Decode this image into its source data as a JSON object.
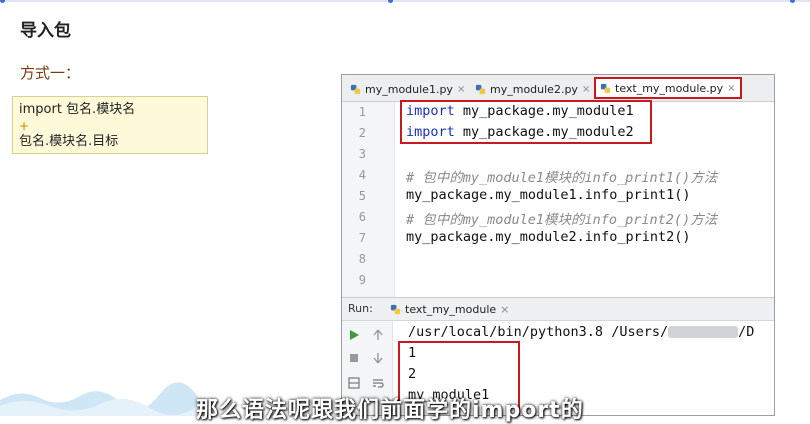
{
  "doc": {
    "title": "导入包",
    "subtitle": "方式一：",
    "note_line1": "import 包名.模块名",
    "note_cursor": "+",
    "note_line2": "包名.模块名.目标"
  },
  "ide": {
    "tabs": [
      {
        "label": "my_module1.py",
        "close": "×"
      },
      {
        "label": "my_module2.py",
        "close": "×"
      },
      {
        "label": "text_my_module.py",
        "close": "×"
      }
    ],
    "line_numbers": [
      "1",
      "2",
      "3",
      "4",
      "5",
      "6",
      "7",
      "8",
      "9"
    ],
    "code": {
      "l1_kw": "import",
      "l1_rest": " my_package.my_module1",
      "l2_kw": "import",
      "l2_rest": " my_package.my_module2",
      "l4": "# 包中的my_module1模块的info_print1()方法",
      "l5": "my_package.my_module1.info_print1()",
      "l6": "# 包中的my_module1模块的info_print2()方法",
      "l7": "my_package.my_module2.info_print2()"
    },
    "run": {
      "label": "Run:",
      "tab_label": "text_my_module",
      "tab_close": "×",
      "cmd_prefix": "/usr/local/bin/python3.8 /Users/",
      "cmd_suffix": "/D",
      "out1": "1",
      "out2": "2",
      "out3": "my_module1"
    }
  },
  "caption": "那么语法呢跟我们前面学的import的",
  "colors": {
    "highlight_border": "#c9191e",
    "keyword": "#1a31b5",
    "comment": "#8a8a8a"
  }
}
